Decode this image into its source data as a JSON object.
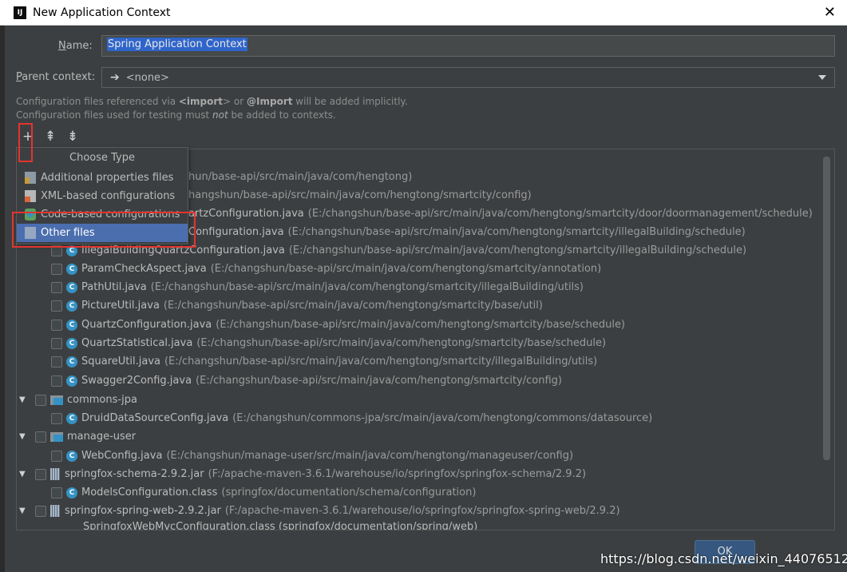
{
  "window": {
    "title": "New Application Context",
    "close_glyph": "✕",
    "app_icon_text": "IJ"
  },
  "form": {
    "name_label_prefix": "",
    "name_label_mnemonic": "N",
    "name_label_rest": "ame:",
    "name_value": "Spring Application Context",
    "parent_label_mnemonic": "P",
    "parent_label_rest": "arent context:",
    "parent_value": "<none>"
  },
  "info": {
    "line1_a": "Configuration files referenced via ",
    "line1_b": "<import",
    "line1_c": "> or ",
    "line1_d": "@Import",
    "line1_e": " will be added implicitly.",
    "line2_a": "Configuration files used for testing must ",
    "line2_b": "not",
    "line2_c": " be added to contexts."
  },
  "toolbar": {
    "add": "+",
    "expand": "⇞",
    "collapse": "⇟"
  },
  "popup": {
    "title": "Choose Type",
    "items": [
      {
        "label": "Additional properties files",
        "icon": "properties-file-icon"
      },
      {
        "label": "XML-based configurations",
        "icon": "xml-file-icon"
      },
      {
        "label": "Code-based configurations",
        "icon": "code-config-icon"
      },
      {
        "label": "Other files",
        "icon": "other-file-icon"
      }
    ]
  },
  "tree": {
    "partial_rows": [
      {
        "tail": "hun/base-api/src/main/java/com/hengtong)"
      },
      {
        "tail": "hangshun/base-api/src/main/java/com/hengtong/smartcity/config)"
      },
      {
        "name": "artzConfiguration.java",
        "path": "(E:/changshun/base-api/src/main/java/com/hengtong/smartcity/door/doormanagement/schedule)"
      },
      {
        "name": "Configuration.java",
        "path": "(E:/changshun/base-api/src/main/java/com/hengtong/smartcity/illegalBuilding/schedule)"
      }
    ],
    "files": [
      {
        "name": "IllegalBuildingQuartzConfiguration.java",
        "path": "(E:/changshun/base-api/src/main/java/com/hengtong/smartcity/illegalBuilding/schedule)"
      },
      {
        "name": "ParamCheckAspect.java",
        "path": "(E:/changshun/base-api/src/main/java/com/hengtong/smartcity/annotation)"
      },
      {
        "name": "PathUtil.java",
        "path": "(E:/changshun/base-api/src/main/java/com/hengtong/smartcity/illegalBuilding/utils)"
      },
      {
        "name": "PictureUtil.java",
        "path": "(E:/changshun/base-api/src/main/java/com/hengtong/smartcity/base/util)"
      },
      {
        "name": "QuartzConfiguration.java",
        "path": "(E:/changshun/base-api/src/main/java/com/hengtong/smartcity/base/schedule)"
      },
      {
        "name": "QuartzStatistical.java",
        "path": "(E:/changshun/base-api/src/main/java/com/hengtong/smartcity/base/schedule)"
      },
      {
        "name": "SquareUtil.java",
        "path": "(E:/changshun/base-api/src/main/java/com/hengtong/smartcity/illegalBuilding/utils)"
      },
      {
        "name": "Swagger2Config.java",
        "path": "(E:/changshun/base-api/src/main/java/com/hengtong/smartcity/config)"
      }
    ],
    "module_commons": {
      "name": "commons-jpa"
    },
    "commons_file": {
      "name": "DruidDataSourceConfig.java",
      "path": "(E:/changshun/commons-jpa/src/main/java/com/hengtong/commons/datasource)"
    },
    "module_user": {
      "name": "manage-user"
    },
    "user_file": {
      "name": "WebConfig.java",
      "path": "(E:/changshun/manage-user/src/main/java/com/hengtong/manageuser/config)"
    },
    "jar_schema": {
      "name": "springfox-schema-2.9.2.jar",
      "path": "(F:/apache-maven-3.6.1/warehouse/io/springfox/springfox-schema/2.9.2)"
    },
    "schema_file": {
      "name": "ModelsConfiguration.class",
      "path": "(springfox/documentation/schema/configuration)"
    },
    "jar_web": {
      "name": "springfox-spring-web-2.9.2.jar",
      "path": "(F:/apache-maven-3.6.1/warehouse/io/springfox/springfox-spring-web/2.9.2)"
    },
    "cut_row": "SpringfoxWebMvcConfiguration.class (springfox/documentation/spring/web)"
  },
  "buttons": {
    "ok": "OK"
  },
  "watermark": "https://blog.csdn.net/weixin_44076512"
}
